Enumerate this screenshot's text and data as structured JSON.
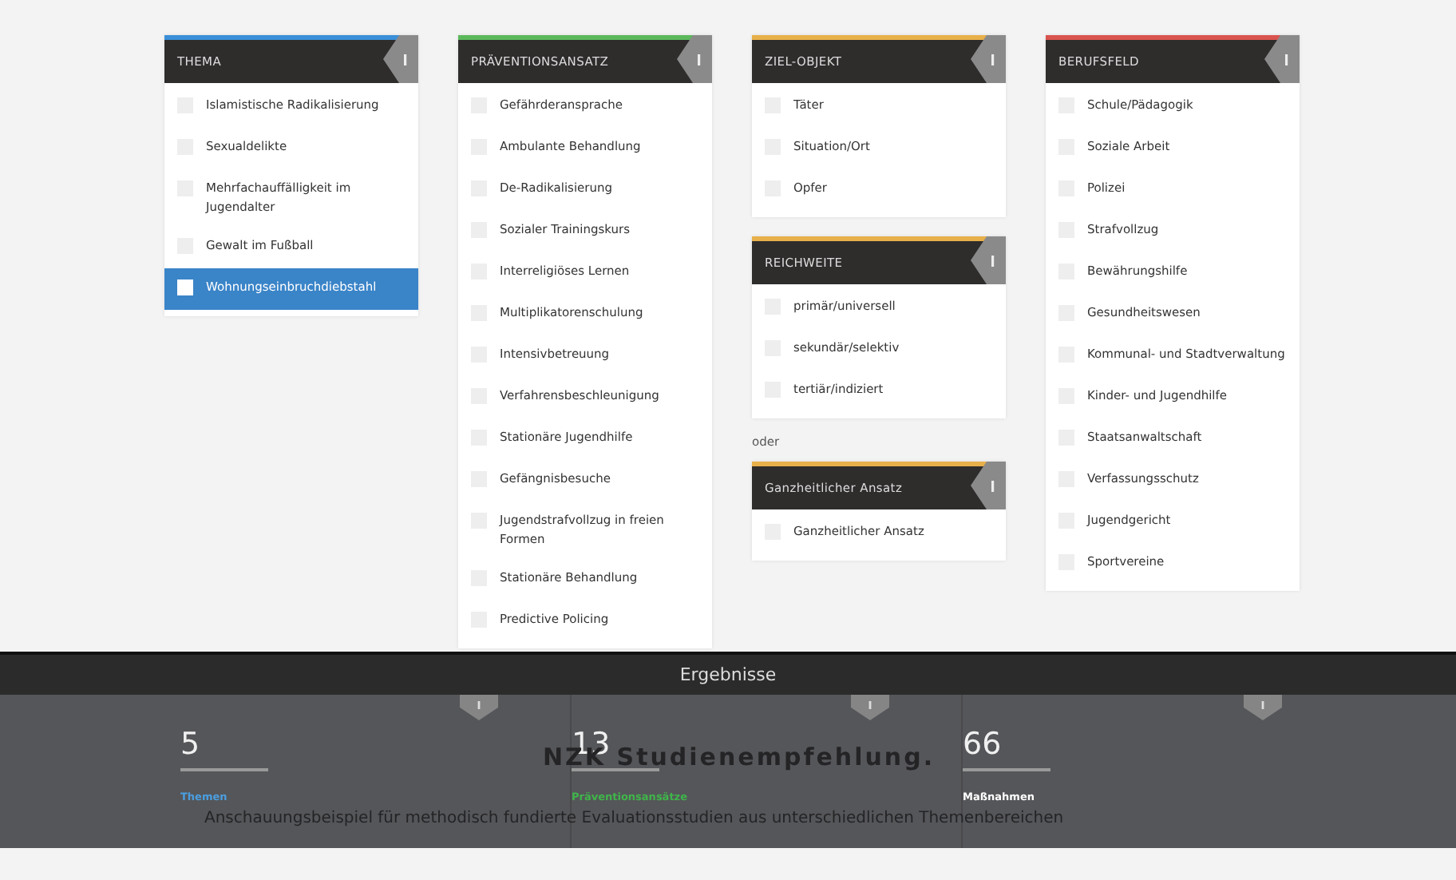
{
  "columns": [
    {
      "blocks": [
        {
          "kind": "panel",
          "title": "THEMA",
          "color": "#3a8fd8",
          "items": [
            {
              "label": "Islamistische Radikalisierung",
              "selected": false
            },
            {
              "label": "Sexualdelikte",
              "selected": false
            },
            {
              "label": "Mehrfachauffälligkeit im Jugendalter",
              "selected": false
            },
            {
              "label": "Gewalt im Fußball",
              "selected": false
            },
            {
              "label": "Wohnungseinbruchdiebstahl",
              "selected": true
            }
          ]
        }
      ]
    },
    {
      "blocks": [
        {
          "kind": "panel",
          "title": "PRÄVENTIONSANSATZ",
          "color": "#5cb85c",
          "items": [
            {
              "label": "Gefährderansprache",
              "selected": false
            },
            {
              "label": "Ambulante Behandlung",
              "selected": false
            },
            {
              "label": "De-Radikalisierung",
              "selected": false
            },
            {
              "label": "Sozialer Trainingskurs",
              "selected": false
            },
            {
              "label": "Interreligiöses Lernen",
              "selected": false
            },
            {
              "label": "Multiplikatorenschulung",
              "selected": false
            },
            {
              "label": "Intensivbetreuung",
              "selected": false
            },
            {
              "label": "Verfahrensbeschleunigung",
              "selected": false
            },
            {
              "label": "Stationäre Jugendhilfe",
              "selected": false
            },
            {
              "label": "Gefängnisbesuche",
              "selected": false
            },
            {
              "label": "Jugendstrafvollzug in freien Formen",
              "selected": false
            },
            {
              "label": "Stationäre Behandlung",
              "selected": false
            },
            {
              "label": "Predictive Policing",
              "selected": false
            }
          ]
        }
      ]
    },
    {
      "blocks": [
        {
          "kind": "panel",
          "title": "ZIEL-OBJEKT",
          "color": "#e8b04a",
          "items": [
            {
              "label": "Täter",
              "selected": false
            },
            {
              "label": "Situation/Ort",
              "selected": false
            },
            {
              "label": "Opfer",
              "selected": false
            }
          ]
        },
        {
          "kind": "panel",
          "title": "REICHWEITE",
          "color": "#e8b04a",
          "items": [
            {
              "label": "primär/universell",
              "selected": false
            },
            {
              "label": "sekundär/selektiv",
              "selected": false
            },
            {
              "label": "tertiär/indiziert",
              "selected": false
            }
          ]
        },
        {
          "kind": "note",
          "text": "oder"
        },
        {
          "kind": "panel",
          "title": "Ganzheitlicher Ansatz",
          "color": "#e8b04a",
          "items": [
            {
              "label": "Ganzheitlicher Ansatz",
              "selected": false
            }
          ]
        }
      ]
    },
    {
      "blocks": [
        {
          "kind": "panel",
          "title": "BERUFSFELD",
          "color": "#d9534f",
          "items": [
            {
              "label": "Schule/Pädagogik",
              "selected": false
            },
            {
              "label": "Soziale Arbeit",
              "selected": false
            },
            {
              "label": "Polizei",
              "selected": false
            },
            {
              "label": "Strafvollzug",
              "selected": false
            },
            {
              "label": "Bewährungshilfe",
              "selected": false
            },
            {
              "label": "Gesundheitswesen",
              "selected": false
            },
            {
              "label": "Kommunal- und Stadtverwaltung",
              "selected": false
            },
            {
              "label": "Kinder- und Jugendhilfe",
              "selected": false
            },
            {
              "label": "Staatsanwaltschaft",
              "selected": false
            },
            {
              "label": "Verfassungsschutz",
              "selected": false
            },
            {
              "label": "Jugendgericht",
              "selected": false
            },
            {
              "label": "Sportvereine",
              "selected": false
            }
          ]
        }
      ]
    }
  ],
  "results": {
    "title": "Ergebnisse",
    "stats": [
      {
        "value": "5",
        "label": "Themen",
        "color": "#4a9ee0"
      },
      {
        "value": "13",
        "label": "Präventionsansätze",
        "color": "#3fb54a"
      },
      {
        "value": "66",
        "label": "Maßnahmen",
        "color": "#ffffff"
      }
    ],
    "background_title": "NZK Studienempfehlung.",
    "background_text": "Anschauungsbeispiel für methodisch fundierte Evaluationsstudien aus unterschiedlichen Themenbereichen"
  }
}
